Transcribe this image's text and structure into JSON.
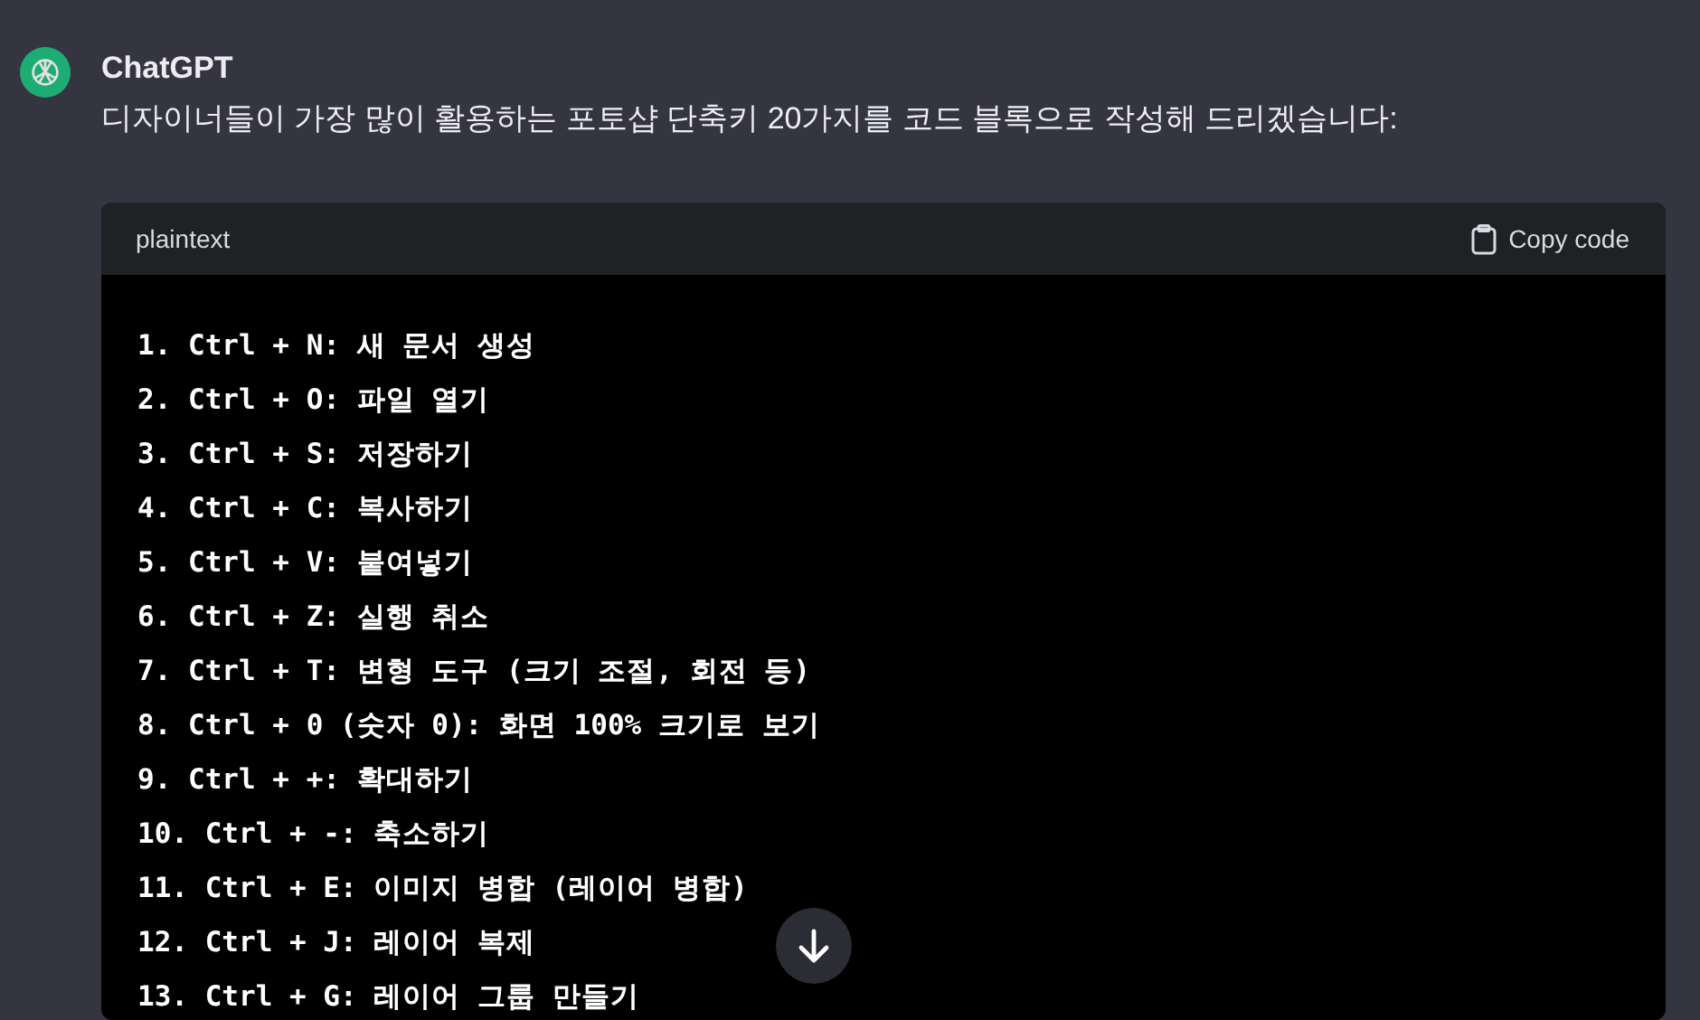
{
  "message": {
    "author": "ChatGPT",
    "text": "디자이너들이 가장 많이 활용하는 포토샵 단축키 20가지를 코드 블록으로 작성해 드리겠습니다:"
  },
  "code_block": {
    "language": "plaintext",
    "copy_label": "Copy code",
    "lines": [
      "1. Ctrl + N: 새 문서 생성",
      "2. Ctrl + O: 파일 열기",
      "3. Ctrl + S: 저장하기",
      "4. Ctrl + C: 복사하기",
      "5. Ctrl + V: 붙여넣기",
      "6. Ctrl + Z: 실행 취소",
      "7. Ctrl + T: 변형 도구 (크기 조절, 회전 등)",
      "8. Ctrl + 0 (숫자 0): 화면 100% 크기로 보기",
      "9. Ctrl + +: 확대하기",
      "10. Ctrl + -: 축소하기",
      "11. Ctrl + E: 이미지 병합 (레이어 병합)",
      "12. Ctrl + J: 레이어 복제",
      "13. Ctrl + G: 레이어 그룹 만들기"
    ]
  }
}
